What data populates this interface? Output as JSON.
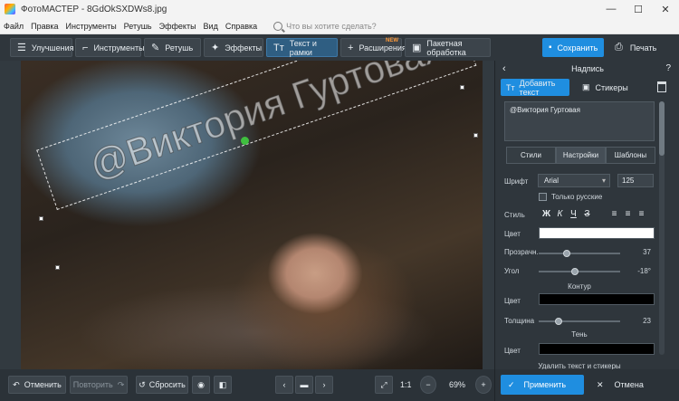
{
  "window": {
    "title": "ФотоМАСТЕР - 8GdOkSXDWs8.jpg"
  },
  "menu": {
    "items": [
      "Файл",
      "Правка",
      "Инструменты",
      "Ретушь",
      "Эффекты",
      "Вид",
      "Справка"
    ],
    "search_placeholder": "Что вы хотите сделать?"
  },
  "toolbar": {
    "tabs": [
      {
        "label": "Улучшения",
        "icon": "sliders-icon"
      },
      {
        "label": "Инструменты",
        "icon": "crop-icon"
      },
      {
        "label": "Ретушь",
        "icon": "brush-icon"
      },
      {
        "label": "Эффекты",
        "icon": "magic-wand-icon"
      },
      {
        "label": "Текст и рамки",
        "icon": "text-icon"
      },
      {
        "label": "Расширения",
        "icon": "plus-icon",
        "badge": "NEW"
      },
      {
        "label": "Пакетная обработка",
        "icon": "batch-icon"
      }
    ],
    "active_tab": "Текст и рамки",
    "save_label": "Сохранить",
    "print_label": "Печать"
  },
  "canvas": {
    "watermark_text": "@Виктория Гуртовая"
  },
  "bottombar": {
    "undo_label": "Отменить",
    "redo_label": "Повторить",
    "reset_label": "Сбросить",
    "zoom_1_1": "1:1",
    "zoom_level": "69%"
  },
  "panel": {
    "title": "Надпись",
    "add_text_tab": "Добавить текст",
    "stickers_tab": "Стикеры",
    "text_value": "@Виктория Гуртовая",
    "subtabs": [
      "Стили",
      "Настройки",
      "Шаблоны"
    ],
    "active_subtab": "Настройки",
    "font_label": "Шрифт",
    "font_value": "Arial",
    "font_size": "125",
    "only_russian_label": "Только русские",
    "style_label": "Стиль",
    "style_buttons": [
      "Ж",
      "К",
      "Ч",
      "З"
    ],
    "color_label": "Цвет",
    "text_color": "#ffffff",
    "transparency_label": "Прозрачн.",
    "transparency_value": "37",
    "angle_label": "Угол",
    "angle_value": "-18°",
    "outline_section": "Контур",
    "outline_color_label": "Цвет",
    "outline_color": "#000000",
    "thickness_label": "Толщина",
    "thickness_value": "23",
    "shadow_section": "Тень",
    "shadow_color_label": "Цвет",
    "shadow_color": "#000000",
    "delete_link": "Удалить текст и стикеры",
    "apply_label": "Применить",
    "cancel_label": "Отмена"
  }
}
